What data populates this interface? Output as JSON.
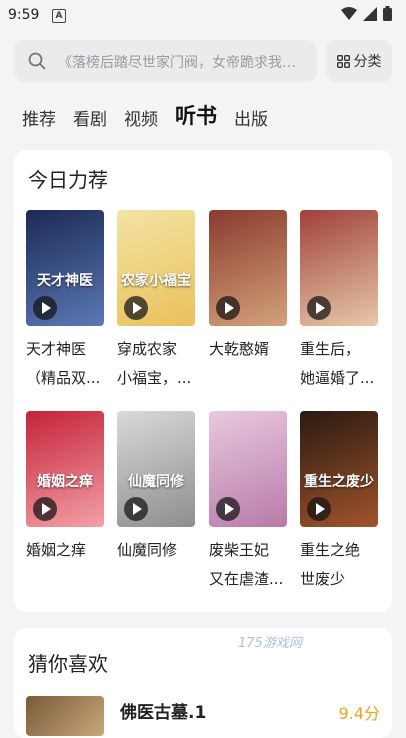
{
  "status": {
    "time": "9:59",
    "notif_letter": "A"
  },
  "search": {
    "placeholder": "《落榜后踏尽世家门阀，女帝跪求我称帝》"
  },
  "category_button": {
    "label": "分类",
    "icon": "grid-icon"
  },
  "tabs": [
    {
      "label": "推荐",
      "active": false
    },
    {
      "label": "看剧",
      "active": false
    },
    {
      "label": "视频",
      "active": false
    },
    {
      "label": "听书",
      "active": true
    },
    {
      "label": "出版",
      "active": false
    }
  ],
  "today_picks": {
    "title": "今日力荐",
    "books": [
      {
        "line1": "天才神医",
        "line2": "（精品双...",
        "cover_text": "天才神医",
        "cover_colors": [
          "#1b2a55",
          "#5b78b5"
        ]
      },
      {
        "line1": "穿成农家",
        "line2": "小福宝，...",
        "cover_text": "农家小福宝",
        "cover_colors": [
          "#f3e3a4",
          "#e9c15a"
        ]
      },
      {
        "line1": "大乾憨婿",
        "line2": "",
        "cover_text": "",
        "cover_colors": [
          "#8b3a2e",
          "#d3a27a"
        ]
      },
      {
        "line1": "重生后，",
        "line2": "她逼婚了...",
        "cover_text": "",
        "cover_colors": [
          "#a0413a",
          "#e7c9a8"
        ]
      },
      {
        "line1": "婚姻之痒",
        "line2": "",
        "cover_text": "婚姻之痒",
        "cover_colors": [
          "#c4233a",
          "#f3a0a6"
        ]
      },
      {
        "line1": "仙魔同修",
        "line2": "",
        "cover_text": "仙魔同修",
        "cover_colors": [
          "#d9d9d9",
          "#8e8e8e"
        ]
      },
      {
        "line1": "废柴王妃",
        "line2": "又在虐渣...",
        "cover_text": "",
        "cover_colors": [
          "#e8c9de",
          "#b87aa9"
        ]
      },
      {
        "line1": "重生之绝",
        "line2": "世废少",
        "cover_text": "重生之废少",
        "cover_colors": [
          "#2a1a12",
          "#a0542a"
        ]
      }
    ]
  },
  "guess": {
    "title": "猜你喜欢",
    "item": {
      "title": "佛医古墓.1",
      "score": "9.4分"
    }
  },
  "watermark": "175游戏网",
  "colors": {
    "accent_score": "#f3a21b",
    "background": "#f4f4f6"
  }
}
